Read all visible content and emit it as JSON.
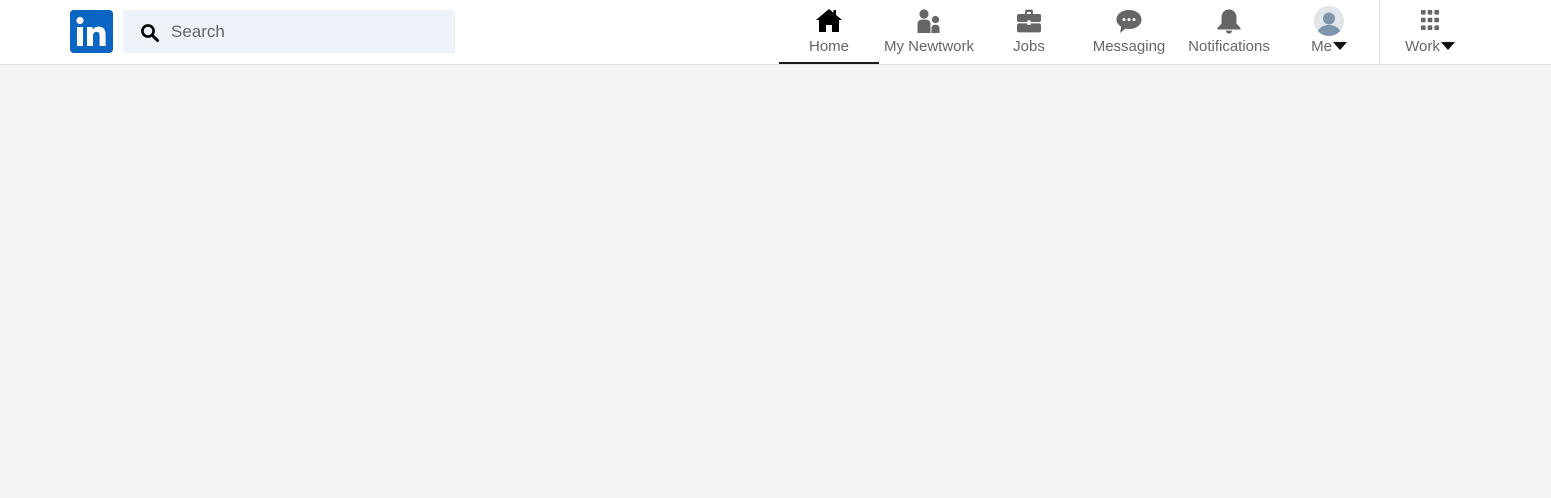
{
  "brand": {
    "logo_text": "in",
    "logo_color": "#0a66c2"
  },
  "search": {
    "placeholder": "Search",
    "value": "",
    "icon": "search-icon"
  },
  "nav": {
    "items": [
      {
        "label": "Home",
        "icon": "home-icon",
        "active": true
      },
      {
        "label": "My Newtwork",
        "icon": "network-icon",
        "active": false
      },
      {
        "label": "Jobs",
        "icon": "briefcase-icon",
        "active": false
      },
      {
        "label": "Messaging",
        "icon": "messaging-icon",
        "active": false
      },
      {
        "label": "Notifications",
        "icon": "bell-icon",
        "active": false
      },
      {
        "label": "Me",
        "icon": "avatar",
        "active": false,
        "dropdown": true
      },
      {
        "label": "Work",
        "icon": "grid-icon",
        "active": false,
        "dropdown": true
      }
    ]
  },
  "colors": {
    "page_background": "#f3f3f3",
    "navbar_background": "#ffffff",
    "search_background": "#edf3f8",
    "active_indicator": "#191919",
    "icon_inactive": "#666666",
    "icon_active": "#000000"
  }
}
